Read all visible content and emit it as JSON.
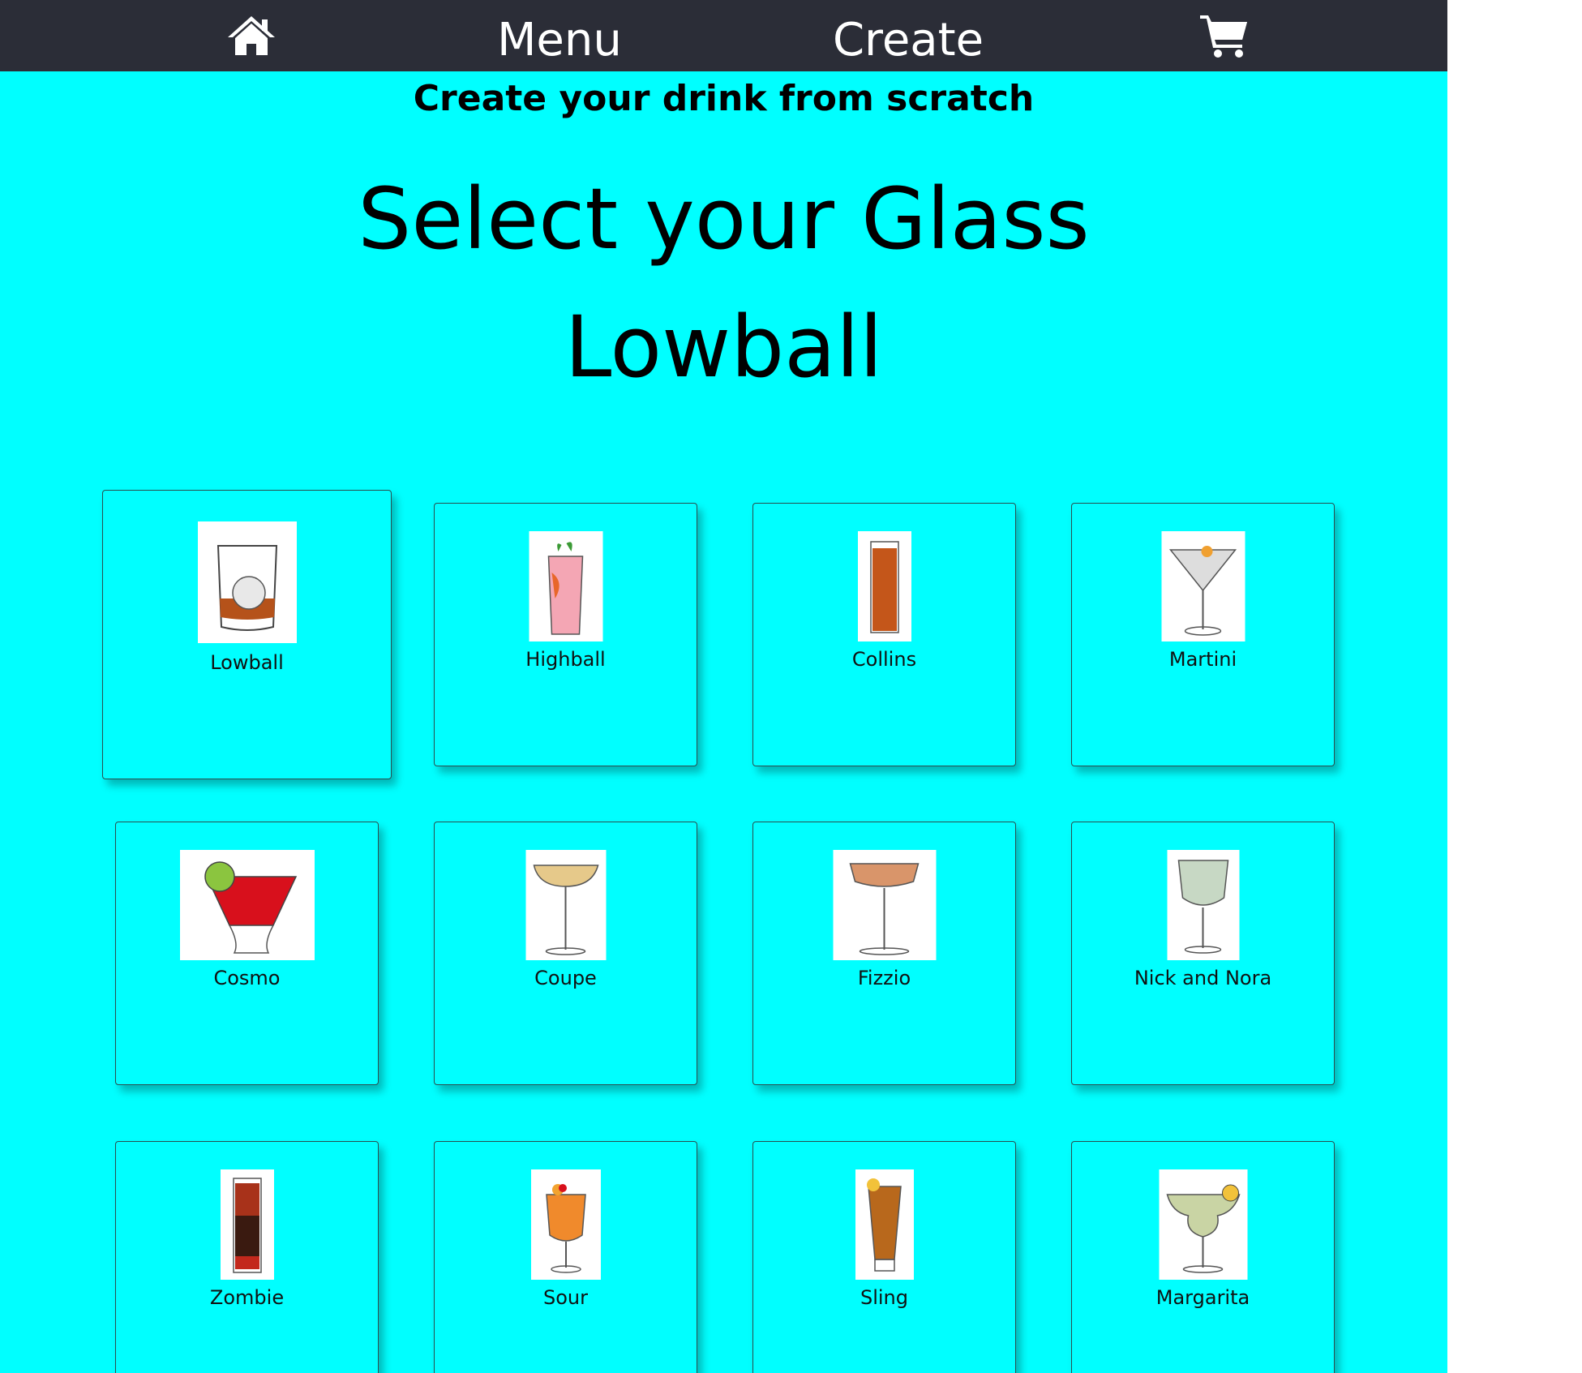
{
  "nav": {
    "home_icon": "home-icon",
    "menu_label": "Menu",
    "create_label": "Create",
    "cart_icon": "cart-icon",
    "background": "#2b2d37"
  },
  "page": {
    "subtitle": "Create your drink from scratch",
    "title": "Select your Glass",
    "selected_glass": "Lowball",
    "background": "#00ffff"
  },
  "glasses": [
    {
      "label": "Lowball",
      "icon": "lowball-glass-icon",
      "selected": true
    },
    {
      "label": "Highball",
      "icon": "highball-glass-icon"
    },
    {
      "label": "Collins",
      "icon": "collins-glass-icon"
    },
    {
      "label": "Martini",
      "icon": "martini-glass-icon"
    },
    {
      "label": "Cosmo",
      "icon": "cosmo-glass-icon"
    },
    {
      "label": "Coupe",
      "icon": "coupe-glass-icon"
    },
    {
      "label": "Fizzio",
      "icon": "fizzio-glass-icon"
    },
    {
      "label": "Nick and Nora",
      "icon": "nick-and-nora-glass-icon"
    },
    {
      "label": "Zombie",
      "icon": "zombie-glass-icon"
    },
    {
      "label": "Sour",
      "icon": "sour-glass-icon"
    },
    {
      "label": "Sling",
      "icon": "sling-glass-icon"
    },
    {
      "label": "Margarita",
      "icon": "margarita-glass-icon"
    }
  ]
}
